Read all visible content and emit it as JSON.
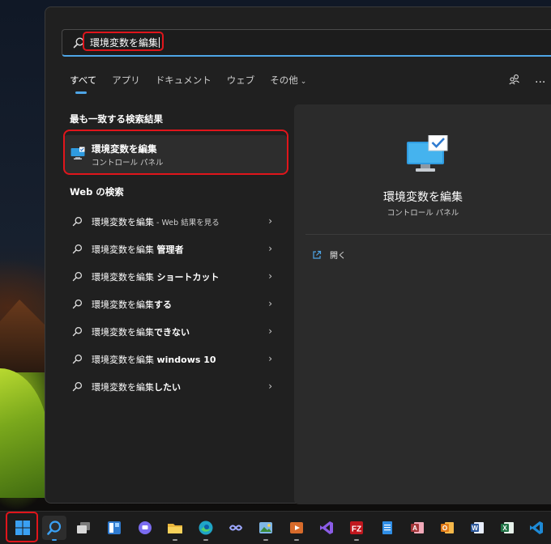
{
  "search": {
    "query": "環境変数を編集"
  },
  "tabs": [
    {
      "label": "すべて",
      "active": true
    },
    {
      "label": "アプリ",
      "active": false
    },
    {
      "label": "ドキュメント",
      "active": false
    },
    {
      "label": "ウェブ",
      "active": false
    },
    {
      "label": "その他",
      "active": false,
      "has_dropdown": true
    }
  ],
  "best_match": {
    "section_title": "最も一致する検索結果",
    "title": "環境変数を編集",
    "subtitle": "コントロール パネル"
  },
  "web_search": {
    "section_title": "Web の検索",
    "items": [
      {
        "prefix": "環境変数を編集",
        "bold": "",
        "suffix": " - Web 結果を見る"
      },
      {
        "prefix": "環境変数を編集 ",
        "bold": "管理者",
        "suffix": ""
      },
      {
        "prefix": "環境変数を編集 ",
        "bold": "ショートカット",
        "suffix": ""
      },
      {
        "prefix": "環境変数を編集",
        "bold": "する",
        "suffix": ""
      },
      {
        "prefix": "環境変数を編集",
        "bold": "できない",
        "suffix": ""
      },
      {
        "prefix": "環境変数を編集 ",
        "bold": "windows 10",
        "suffix": ""
      },
      {
        "prefix": "環境変数を編集",
        "bold": "したい",
        "suffix": ""
      }
    ]
  },
  "preview": {
    "title": "環境変数を編集",
    "subtitle": "コントロール パネル",
    "action_open": "開く"
  },
  "top_right": {
    "more": "..."
  },
  "colors": {
    "accent": "#4ea5e6",
    "highlight_red": "#e0151b",
    "panel_bg": "#202020",
    "preview_bg": "#2b2b2b"
  },
  "taskbar": {
    "icons": [
      "windows-start-icon",
      "search-icon",
      "task-view-icon",
      "widgets-icon",
      "teams-chat-icon",
      "file-explorer-icon",
      "edge-icon",
      "infinity-app-icon",
      "photos-icon",
      "media-player-icon",
      "visual-studio-icon",
      "filezilla-icon",
      "notepad-icon",
      "access-icon",
      "outlook-icon",
      "word-icon",
      "excel-icon",
      "vscode-icon"
    ]
  }
}
